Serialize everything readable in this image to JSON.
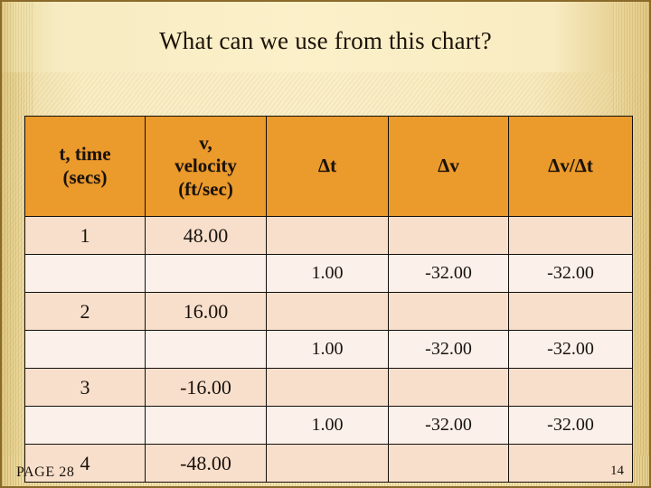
{
  "slide": {
    "title": "What can we use from this chart?",
    "page_label": "PAGE 28",
    "page_number": "14",
    "accent_header_color": "#eb9a2c",
    "row_alt_color_a": "#f8dfcc",
    "row_alt_color_b": "#fbf0ea",
    "background_color": "#fbf0cb"
  },
  "chart_data": {
    "type": "table",
    "title": "What can we use from this chart?",
    "columns": [
      "t, time (secs)",
      "v, velocity (ft/sec)",
      "Δt",
      "Δv",
      "Δv/Δt"
    ],
    "column_header_lines": [
      [
        "t, time",
        "(secs)"
      ],
      [
        "v,",
        "velocity",
        "(ft/sec)"
      ],
      [
        "Δt"
      ],
      [
        "Δv"
      ],
      [
        "Δv/Δt"
      ]
    ],
    "rows": [
      {
        "kind": "value",
        "cells": [
          "1",
          "48.00",
          "",
          "",
          ""
        ]
      },
      {
        "kind": "delta",
        "cells": [
          "",
          "",
          "1.00",
          "-32.00",
          "-32.00"
        ]
      },
      {
        "kind": "value",
        "cells": [
          "2",
          "16.00",
          "",
          "",
          ""
        ]
      },
      {
        "kind": "delta",
        "cells": [
          "",
          "",
          "1.00",
          "-32.00",
          "-32.00"
        ]
      },
      {
        "kind": "value",
        "cells": [
          "3",
          "-16.00",
          "",
          "",
          ""
        ]
      },
      {
        "kind": "delta",
        "cells": [
          "",
          "",
          "1.00",
          "-32.00",
          "-32.00"
        ]
      },
      {
        "kind": "value",
        "cells": [
          "4",
          "-48.00",
          "",
          "",
          ""
        ]
      }
    ],
    "t": [
      1,
      2,
      3,
      4
    ],
    "v": [
      48.0,
      16.0,
      -16.0,
      -48.0
    ],
    "delta_t": [
      1.0,
      1.0,
      1.0
    ],
    "delta_v": [
      -32.0,
      -32.0,
      -32.0
    ],
    "delta_v_over_delta_t": [
      -32.0,
      -32.0,
      -32.0
    ],
    "xlabel": "t, time (secs)",
    "ylabel": "v, velocity (ft/sec)"
  }
}
